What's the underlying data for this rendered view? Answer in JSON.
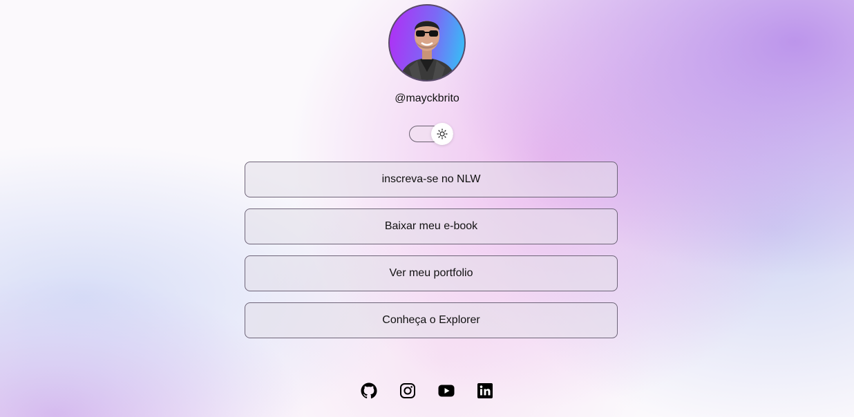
{
  "profile": {
    "username": "@mayckbrito",
    "avatar_alt": ""
  },
  "theme_switch": {
    "state": "light",
    "icon": "sun-icon"
  },
  "links": [
    {
      "label": "inscreva-se no NLW"
    },
    {
      "label": "Baixar meu e-book"
    },
    {
      "label": "Ver meu portfolio"
    },
    {
      "label": "Conheça o Explorer"
    }
  ],
  "social": [
    {
      "icon": "github-icon"
    },
    {
      "icon": "instagram-icon"
    },
    {
      "icon": "youtube-icon"
    },
    {
      "icon": "linkedin-icon"
    }
  ],
  "colors": {
    "text": "#111111",
    "button_border": "#6e6478",
    "avatar_gradient_start": "#b32cf5",
    "avatar_gradient_end": "#2fc8f7"
  }
}
